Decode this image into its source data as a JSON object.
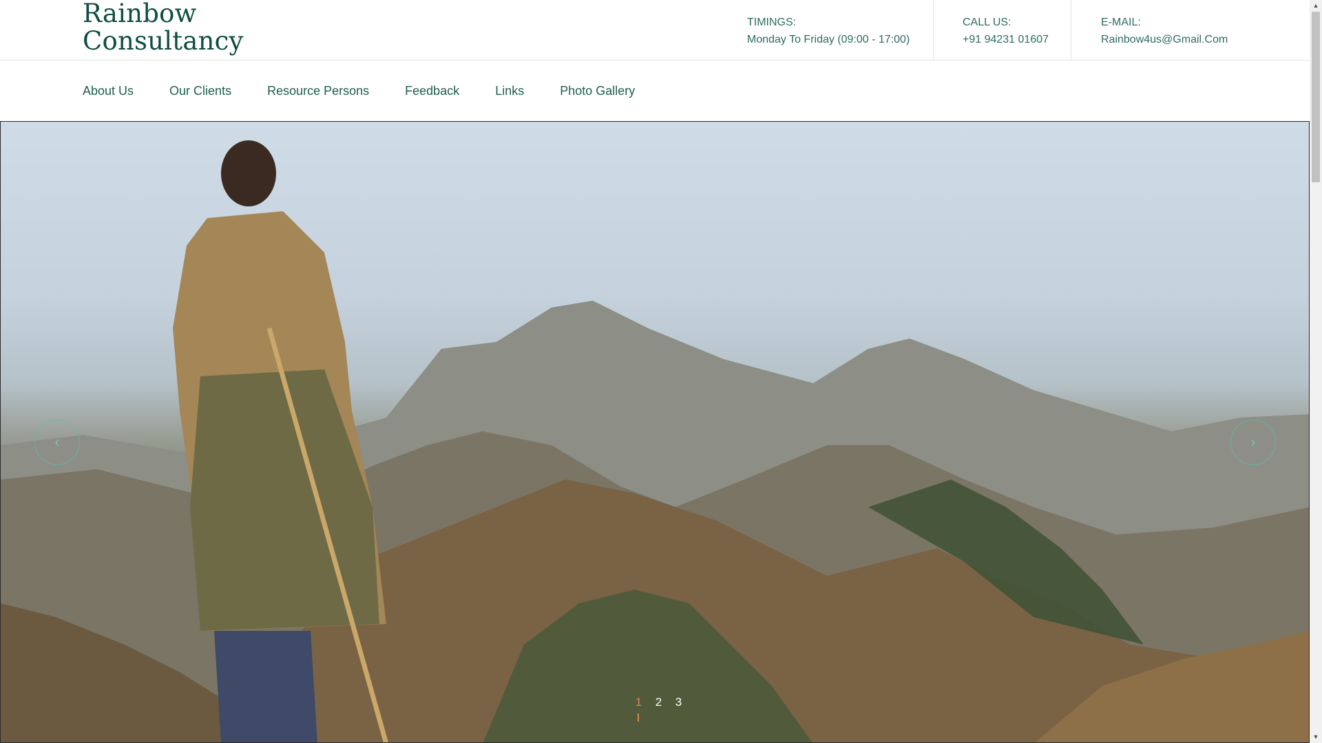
{
  "brand": {
    "line1": "Rainbow",
    "line2": "Consultancy"
  },
  "header": {
    "timing": {
      "label": "TIMINGS:",
      "value": "Monday To Friday (09:00 - 17:00)"
    },
    "call": {
      "label": "CALL US:",
      "value": "+91 94231 01607"
    },
    "email": {
      "label": "E-MAIL:",
      "value": "Rainbow4us@Gmail.Com"
    }
  },
  "nav": {
    "items": [
      {
        "label": "About Us"
      },
      {
        "label": "Our Clients"
      },
      {
        "label": "Resource Persons"
      },
      {
        "label": "Feedback"
      },
      {
        "label": "Links"
      },
      {
        "label": "Photo Gallery"
      }
    ]
  },
  "slider": {
    "prev_icon": "chevron-left-icon",
    "next_icon": "chevron-right-icon",
    "prev_glyph": "‹",
    "next_glyph": "›",
    "active_slide": 1,
    "pages": [
      "1",
      "2",
      "3"
    ]
  },
  "colors": {
    "brand": "#0e4d43",
    "text": "#1f5d52",
    "active_dot": "#e0834e"
  }
}
